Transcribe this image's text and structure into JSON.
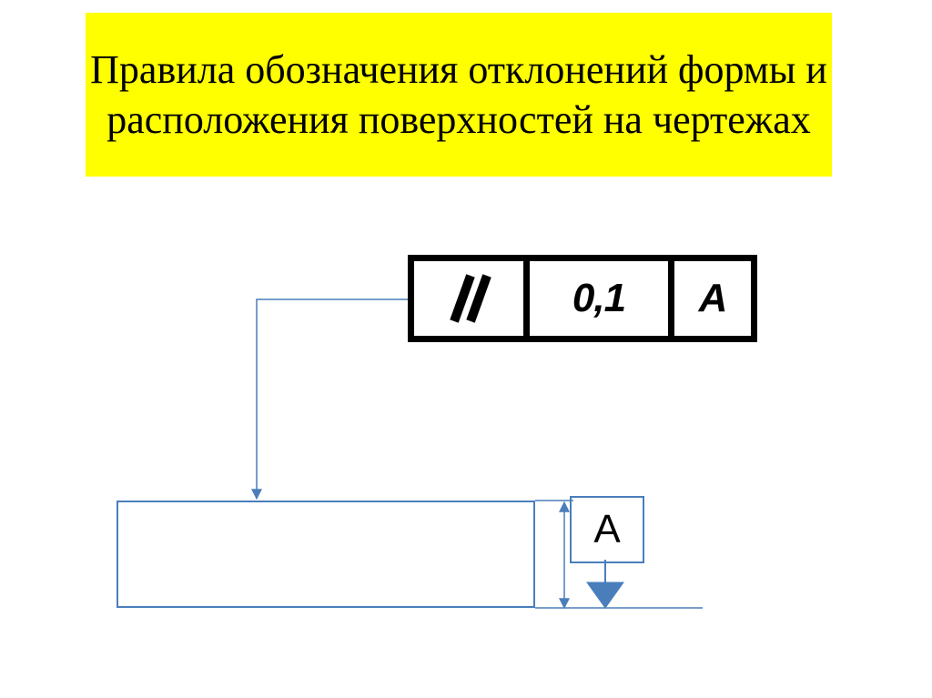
{
  "title": "Правила обозначения отклонений формы и расположения поверхностей на чертежах",
  "feature_control_frame": {
    "symbol": "parallelism",
    "tolerance": "0,1",
    "datum": "А"
  },
  "datum_label": "А",
  "colors": {
    "banner_bg": "#ffff00",
    "line_blue": "#4a7ebb",
    "black": "#000000"
  }
}
